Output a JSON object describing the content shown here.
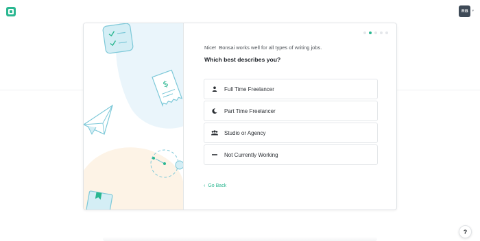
{
  "header": {
    "logo_icon": "bonsai-logo-icon",
    "user_initials": "RB",
    "caret": "▾"
  },
  "progress": {
    "total_steps": 5,
    "current_step": 2
  },
  "main": {
    "intro": "Nice!  Bonsai works well for all types of writing jobs.",
    "question": "Which best describes you?",
    "options": [
      {
        "label": "Full Time Freelancer",
        "icon": "person-icon"
      },
      {
        "label": "Part Time Freelancer",
        "icon": "moon-icon"
      },
      {
        "label": "Studio or Agency",
        "icon": "group-icon"
      },
      {
        "label": "Not Currently Working",
        "icon": "dash-icon"
      }
    ],
    "back": {
      "label": "Go Back",
      "icon": "chevron-left-icon"
    }
  },
  "help": {
    "label": "?"
  },
  "colors": {
    "accent": "#2bb791",
    "illustration_blue": "#eaf5fb",
    "illustration_peach": "#fdf3e6",
    "avatar_bg": "#3e4a57"
  }
}
